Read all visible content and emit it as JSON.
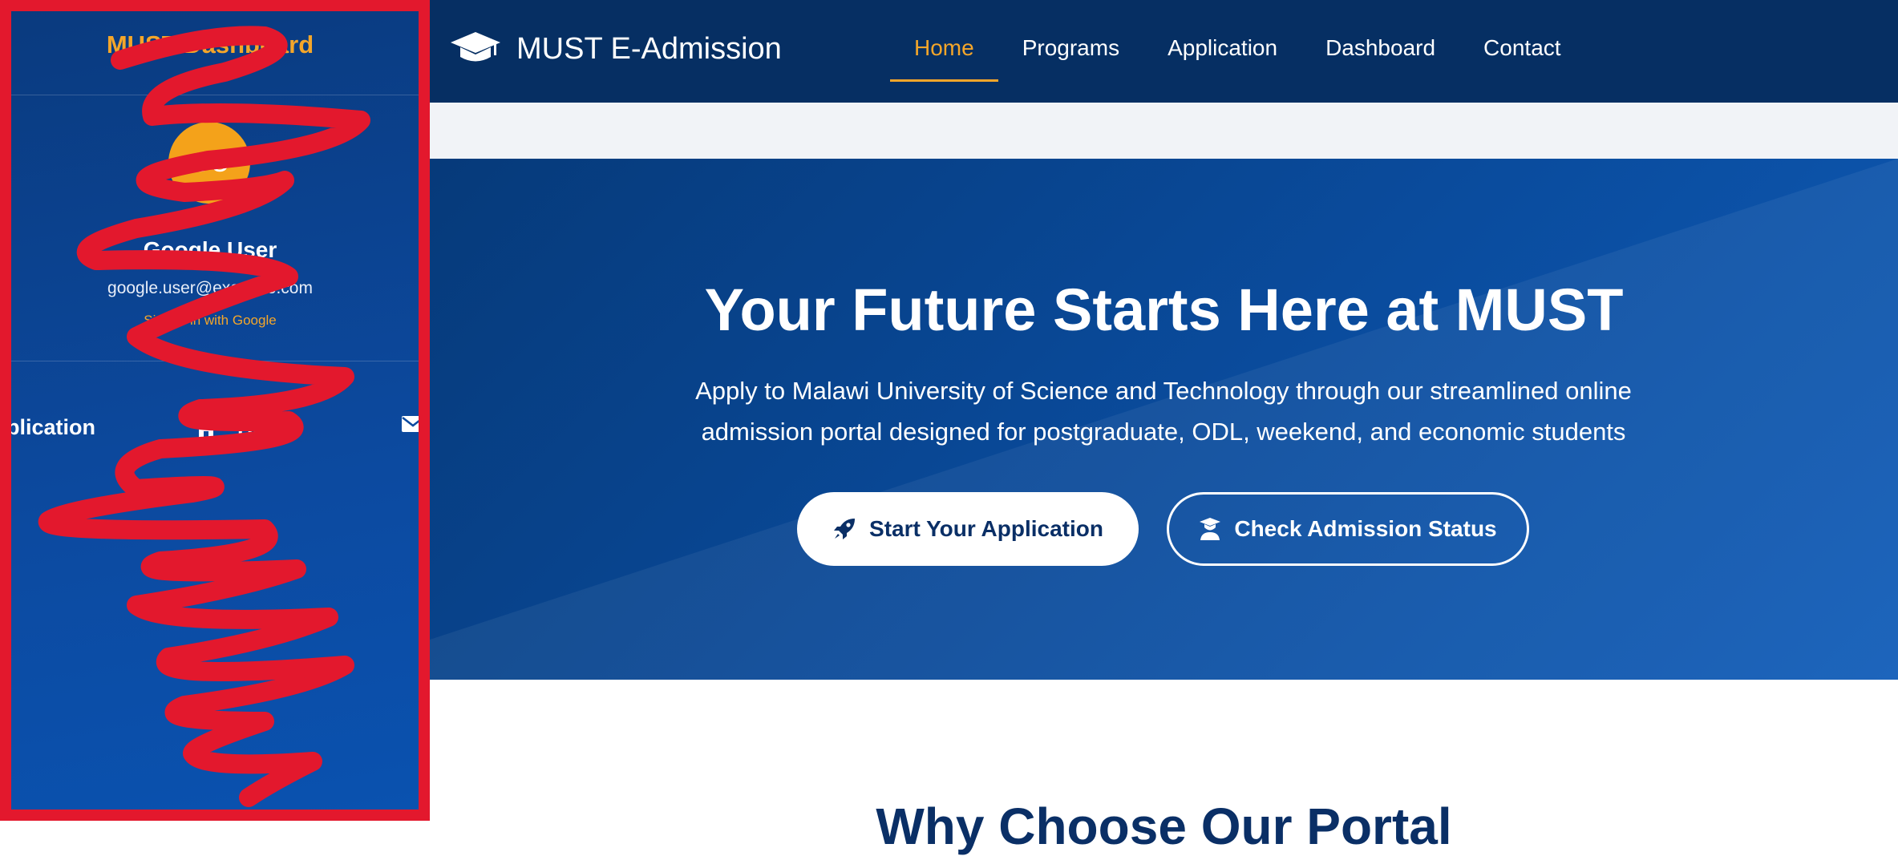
{
  "sidebar": {
    "title": "MUST Dashboard",
    "avatar_initials": "GU",
    "user_name": "Google User",
    "user_email": "google.user@example.com",
    "signed_in_text": "Signed in with Google",
    "nav": [
      {
        "label": "Application",
        "icon": "file-icon"
      },
      {
        "label": "Home",
        "icon": "home-icon"
      },
      {
        "label": "",
        "icon": "envelope-icon"
      }
    ],
    "annotation_color": "#e3182d"
  },
  "topnav": {
    "brand": "MUST E-Admission",
    "brand_icon": "graduation-cap-icon",
    "links": [
      {
        "label": "Home",
        "active": true
      },
      {
        "label": "Programs",
        "active": false
      },
      {
        "label": "Application",
        "active": false
      },
      {
        "label": "Dashboard",
        "active": false
      },
      {
        "label": "Contact",
        "active": false
      }
    ]
  },
  "hero": {
    "title": "Your Future Starts Here at MUST",
    "subtitle": "Apply to Malawi University of Science and Technology through our streamlined online admission portal designed for postgraduate, ODL, weekend, and economic students",
    "primary_button": {
      "label": "Start Your Application",
      "icon": "rocket-icon"
    },
    "secondary_button": {
      "label": "Check Admission Status",
      "icon": "graduate-icon"
    }
  },
  "next_section": {
    "heading": "Why Choose Our Portal"
  },
  "colors": {
    "accent": "#f4a62a",
    "navy": "#062f63",
    "hero_blue": "#0a4c9e",
    "annotation_red": "#e3182d"
  }
}
